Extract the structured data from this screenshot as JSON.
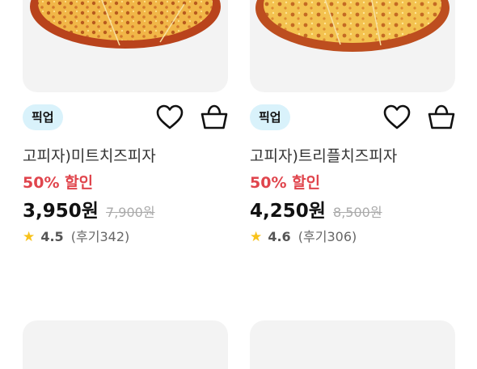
{
  "products": [
    {
      "badge": "픽업",
      "name": "고피자)미트치즈피자",
      "discount": "50% 할인",
      "price": "3,950원",
      "original_price": "7,900원",
      "rating": "4.5",
      "reviews": "(후기342)"
    },
    {
      "badge": "픽업",
      "name": "고피자)트리플치즈피자",
      "discount": "50% 할인",
      "price": "4,250원",
      "original_price": "8,500원",
      "rating": "4.6",
      "reviews": "(후기306)"
    }
  ],
  "icons": {
    "wishlist": "heart-outline-icon",
    "cart": "basket-icon",
    "rating": "star-icon"
  },
  "colors": {
    "badge_bg": "#d9f2fb",
    "discount": "#e0454d",
    "star": "#f8c21b"
  }
}
